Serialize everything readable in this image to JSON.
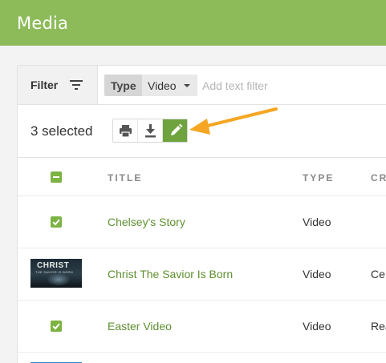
{
  "header": {
    "title": "Media"
  },
  "filterbar": {
    "filter_label": "Filter",
    "chip_key": "Type",
    "chip_value": "Video",
    "text_filter_placeholder": "Add text filter"
  },
  "selection": {
    "count_label": "3 selected",
    "tools": [
      "print-icon",
      "download-icon",
      "pencil-icon"
    ]
  },
  "table": {
    "columns": [
      "TITLE",
      "TYPE",
      "CR"
    ],
    "rows": [
      {
        "title": "Chelsey's Story",
        "type": "Video",
        "extra": "",
        "checked": true
      },
      {
        "title": "Christ The Savior Is Born",
        "type": "Video",
        "extra": "Ce",
        "thumbnail_title": "CHRIST",
        "thumbnail_subtitle": "THE SAVIOR IS BORN"
      },
      {
        "title": "Easter Video",
        "type": "Video",
        "extra": "Rea",
        "checked": true
      }
    ]
  },
  "colors": {
    "header_bg": "#8dbb5a",
    "accent": "#6ea33d",
    "link": "#5f8f30",
    "annotation_arrow": "#f5a623"
  }
}
